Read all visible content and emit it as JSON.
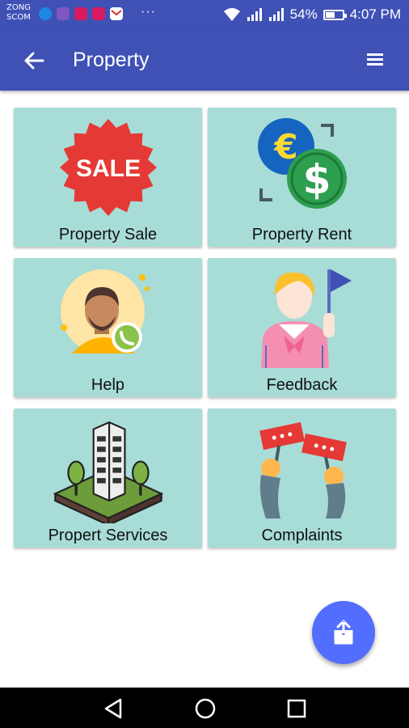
{
  "status_bar": {
    "carrier_line1": "ZONG",
    "carrier_line2": "SCOM",
    "overflow": "···",
    "battery": "54%",
    "battery_level": 0.54,
    "time": "4:07 PM"
  },
  "app_bar": {
    "title": "Property",
    "back_icon": "arrow-back-icon",
    "menu_icon": "hamburger-menu-icon"
  },
  "tiles": [
    {
      "label": "Property Sale",
      "icon": "sale-badge-icon"
    },
    {
      "label": "Property Rent",
      "icon": "currency-exchange-icon"
    },
    {
      "label": "Help",
      "icon": "support-agent-icon"
    },
    {
      "label": "Feedback",
      "icon": "person-flag-icon"
    },
    {
      "label": "Propert Services",
      "icon": "building-icon"
    },
    {
      "label": "Complaints",
      "icon": "protest-signs-icon"
    }
  ],
  "sale_badge_text": "SALE",
  "currency_symbols": {
    "euro": "€",
    "dollar": "$"
  },
  "fab": {
    "icon": "share-icon"
  },
  "colors": {
    "primary": "#3f51b5",
    "tile_bg": "#a8dcd7",
    "fab": "#536dfe"
  }
}
